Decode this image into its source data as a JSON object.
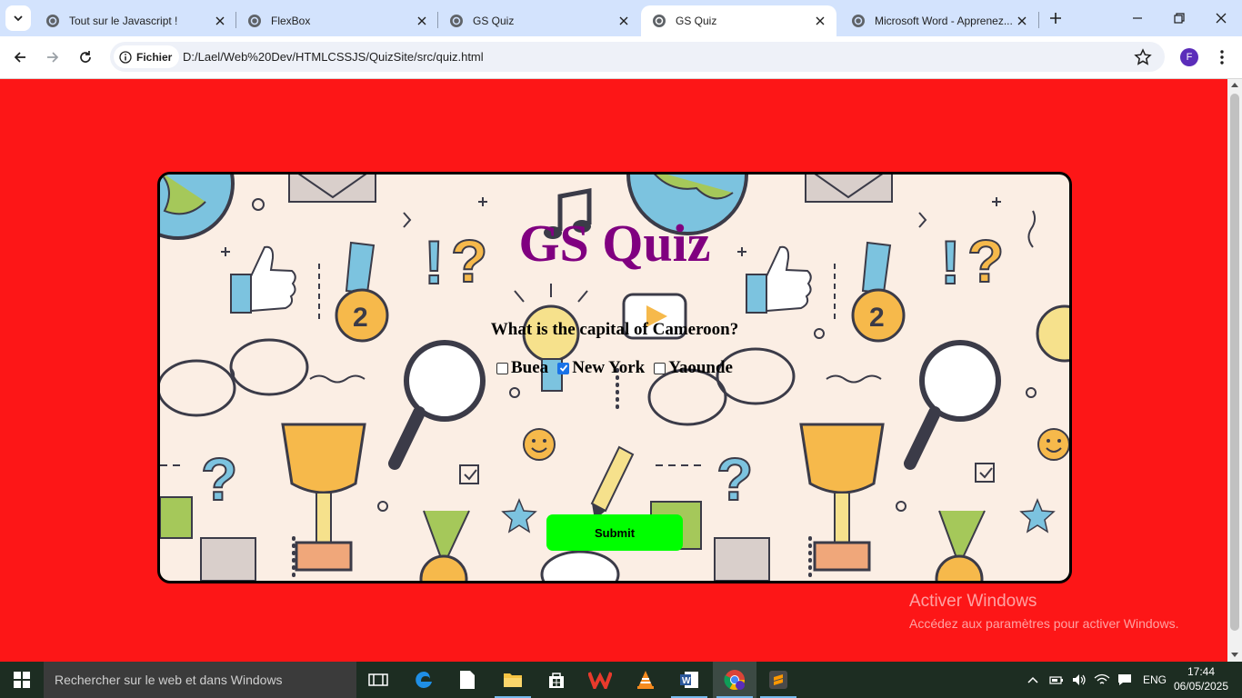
{
  "browser": {
    "tabs": [
      {
        "title": "Tout sur le Javascript !",
        "active": false
      },
      {
        "title": "FlexBox",
        "active": false
      },
      {
        "title": "GS Quiz",
        "active": false
      },
      {
        "title": "GS Quiz",
        "active": true
      },
      {
        "title": "Microsoft Word - Apprenez...",
        "active": false
      }
    ],
    "address_chip": "Fichier",
    "url": "D:/Lael/Web%20Dev/HTMLCSSJS/QuizSite/src/quiz.html",
    "profile_initial": "F"
  },
  "page": {
    "background_color": "#fd1617",
    "card": {
      "title": "GS Quiz",
      "title_color": "#800080",
      "question": "What is the capital of Cameroon?",
      "options": [
        {
          "label": "Buea",
          "checked": false
        },
        {
          "label": "New York",
          "checked": true
        },
        {
          "label": "Yaounde",
          "checked": false
        }
      ],
      "submit_label": "Submit",
      "submit_color": "#00ff00"
    },
    "watermark": {
      "line1": "Activer Windows",
      "line2": "Accédez aux paramètres pour activer Windows."
    }
  },
  "taskbar": {
    "search_placeholder": "Rechercher sur le web et dans Windows",
    "language": "ENG",
    "time": "17:44",
    "date": "06/05/2025",
    "pinned_icons": [
      "task-view-icon",
      "edge-icon",
      "file-icon",
      "file-explorer-icon",
      "store-icon",
      "wps-office-icon",
      "vlc-icon",
      "word-icon",
      "chrome-icon",
      "sublime-text-icon"
    ]
  }
}
